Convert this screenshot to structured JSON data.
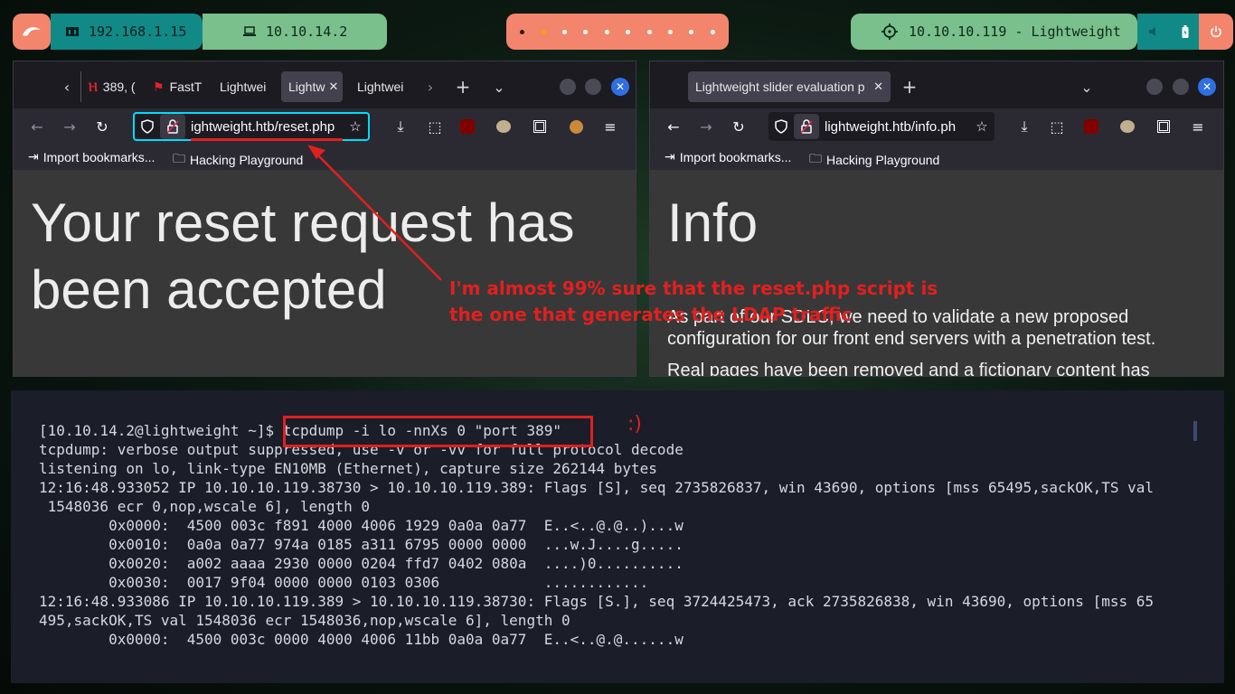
{
  "topbar": {
    "local_ip": "192.168.1.15",
    "vpn_ip": "10.10.14.2",
    "target": "10.10.10.119 - Lightweight",
    "workspace_count": 10,
    "active_workspace": 2,
    "colors": {
      "salmon": "#f3856c",
      "teal": "#118a87",
      "green": "#79c08c"
    }
  },
  "browser_left": {
    "tabs": [
      "389, (",
      "FastT",
      "Lightwei",
      "Lightw",
      "Lightwei"
    ],
    "active_tab": 3,
    "url": "ightweight.htb/reset.php",
    "bookmarks": [
      "Import bookmarks...",
      "Hacking Playground"
    ],
    "page_title": "Your reset request has been accepted"
  },
  "browser_right": {
    "tab": "Lightweight slider evaluation p",
    "url": "lightweight.htb/info.ph",
    "bookmarks": [
      "Import bookmarks...",
      "Hacking Playground"
    ],
    "page_title": "Info",
    "paragraphs": [
      "As part of our SDLC, we need to validate a new proposed configuration for our front end servers with a penetration test.",
      "Real pages have been removed and a fictionary content has"
    ]
  },
  "terminal": {
    "prompt": "[10.10.14.2@lightweight ~]$ ",
    "command": "tcpdump -i lo -nnXs 0 \"port 389\"",
    "lines": [
      "tcpdump: verbose output suppressed, use -v or -vv for full protocol decode",
      "listening on lo, link-type EN10MB (Ethernet), capture size 262144 bytes",
      "12:16:48.933052 IP 10.10.10.119.38730 > 10.10.10.119.389: Flags [S], seq 2735826837, win 43690, options [mss 65495,sackOK,TS val",
      " 1548036 ecr 0,nop,wscale 6], length 0",
      "        0x0000:  4500 003c f891 4000 4006 1929 0a0a 0a77  E..<..@.@..)...w",
      "        0x0010:  0a0a 0a77 974a 0185 a311 6795 0000 0000  ...w.J....g.....",
      "        0x0020:  a002 aaaa 2930 0000 0204 ffd7 0402 080a  ....)0..........",
      "        0x0030:  0017 9f04 0000 0000 0103 0306            ............",
      "12:16:48.933086 IP 10.10.10.119.389 > 10.10.10.119.38730: Flags [S.], seq 3724425473, ack 2735826838, win 43690, options [mss 65",
      "495,sackOK,TS val 1548036 ecr 1548036,nop,wscale 6], length 0",
      "        0x0000:  4500 003c 0000 4000 4006 11bb 0a0a 0a77  E..<..@.@......w"
    ]
  },
  "annotations": {
    "note": "I'm almost 99% sure that the reset.php script is the one that generates the LDAP traffic",
    "smiley": ":)",
    "color": "#e02020"
  },
  "icons": {
    "kali": "kali-dragon-icon",
    "network": "network-icon",
    "laptop": "laptop-icon",
    "target": "crosshair-icon",
    "volume": "volume-icon",
    "battery": "battery-icon",
    "power": "power-icon"
  }
}
